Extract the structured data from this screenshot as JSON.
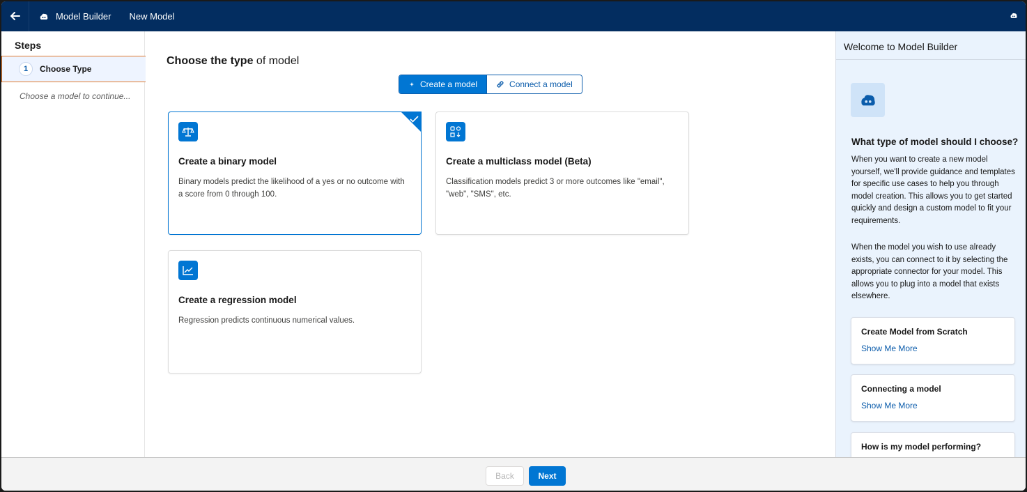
{
  "header": {
    "back_icon": "arrow-left-icon",
    "app_icon": "einstein-icon",
    "app_name": "Model Builder",
    "tab": "New Model",
    "right_icon": "einstein-icon"
  },
  "sidebar": {
    "title": "Steps",
    "steps": [
      {
        "number": "1",
        "label": "Choose Type"
      }
    ],
    "hint": "Choose a model to continue..."
  },
  "main": {
    "title_bold": "Choose the type",
    "title_rest": " of model",
    "segmented": {
      "create_label": "Create a model",
      "create_icon": "einstein-sparkle-icon",
      "connect_label": "Connect a model",
      "connect_icon": "link-icon"
    },
    "cards": [
      {
        "icon": "scales-icon",
        "title": "Create a binary model",
        "description": "Binary models predict the likelihood of a yes or no outcome with a score from 0 through 100.",
        "selected": true
      },
      {
        "icon": "multiclass-icon",
        "title": "Create a multiclass model (Beta)",
        "description": "Classification models predict 3 or more outcomes like \"email\", \"web\", \"SMS\", etc.",
        "selected": false
      },
      {
        "icon": "line-chart-icon",
        "title": "Create a regression model",
        "description": "Regression predicts continuous numerical values.",
        "selected": false
      }
    ]
  },
  "right_panel": {
    "title": "Welcome to Model Builder",
    "logo_icon": "einstein-icon",
    "question": "What type of model should I choose?",
    "paragraph1": "When you want to create a new model yourself, we'll provide guidance and templates for specific use cases to help you through model creation. This allows you to get started quickly and design a custom model to fit your requirements.",
    "paragraph2": "When the model you wish to use already exists, you can connect to it by selecting the appropriate connector for your model. This allows you to plug into a model that exists elsewhere.",
    "cards": [
      {
        "title": "Create Model from Scratch",
        "link": "Show Me More"
      },
      {
        "title": "Connecting a model",
        "link": "Show Me More"
      },
      {
        "title": "How is my model performing?",
        "link": ""
      }
    ]
  },
  "footer": {
    "back_label": "Back",
    "next_label": "Next"
  },
  "colors": {
    "header_bg": "#032d60",
    "brand_blue": "#0176d3",
    "link_blue": "#0b5cab",
    "step_highlight_border": "#e07a2e",
    "right_panel_bg": "#eaf3fd"
  }
}
